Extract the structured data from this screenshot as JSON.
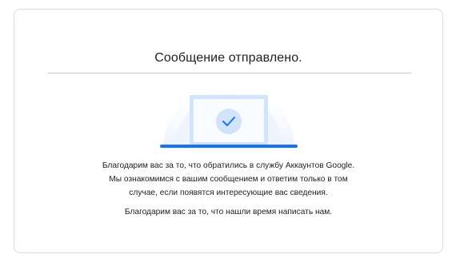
{
  "dialog": {
    "title": "Сообщение отправлено.",
    "message_lines": [
      "Благодарим вас за то, что обратились в службу Аккаунтов Google.",
      "Мы ознакомимся с вашим сообщением и ответим только в том",
      "случае, если появятся интересующие вас сведения."
    ],
    "thanks": "Благодарим вас за то, что нашли время написать нам."
  },
  "illustration": {
    "icon": "laptop-checkmark-icon",
    "colors": {
      "halo": "#e8f0fe",
      "screen_frame": "#aecbfa",
      "screen_fill": "#ffffff",
      "check_circle": "#d2e3fc",
      "check": "#1a73e8",
      "base": "#1a73e8"
    }
  },
  "colors": {
    "text": "#202124",
    "border": "#dadce0",
    "divider": "#c4c7cc"
  }
}
